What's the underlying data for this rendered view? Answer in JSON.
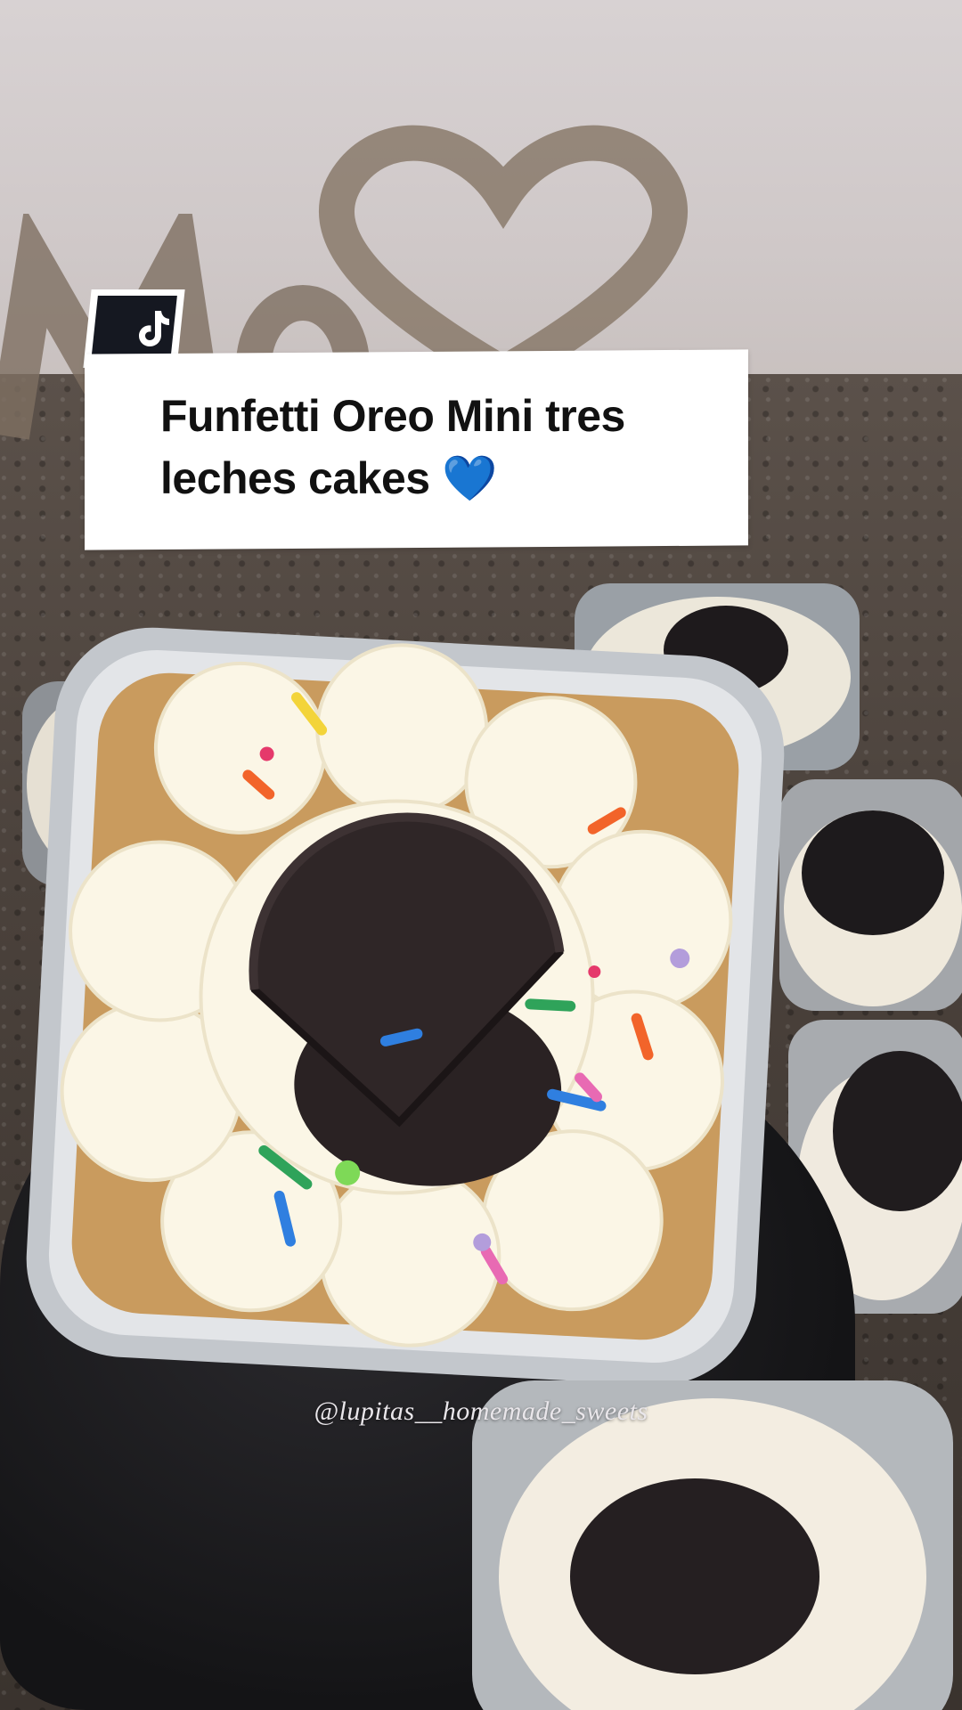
{
  "caption": {
    "text": "Funfetti Oreo Mini tres leches cakes 💙"
  },
  "watermark": {
    "handle": "@lupitas__homemade_sweets"
  },
  "icons": {
    "logo": "tiktok-logo-icon"
  },
  "colors": {
    "caption_bg": "#ffffff",
    "caption_text": "#111111",
    "badge_bg": "#151821"
  }
}
